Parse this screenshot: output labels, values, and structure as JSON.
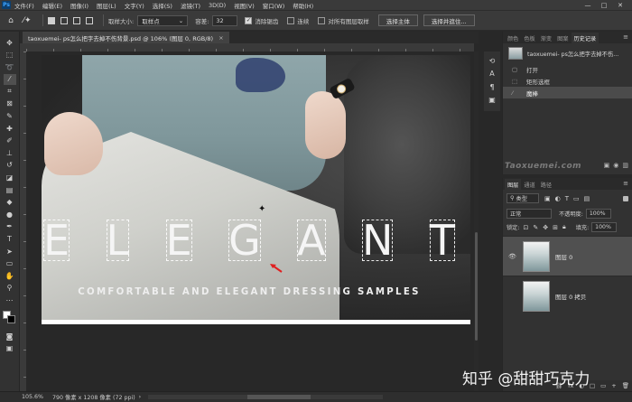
{
  "app": {
    "logo": "Ps"
  },
  "menu": [
    "文件(F)",
    "编辑(E)",
    "图像(I)",
    "图层(L)",
    "文字(Y)",
    "选择(S)",
    "滤镜(T)",
    "3D(D)",
    "视图(V)",
    "窗口(W)",
    "帮助(H)"
  ],
  "window_controls": {
    "minimize": "—",
    "maximize": "□",
    "close": "✕"
  },
  "options": {
    "sample_size_label": "取样大小:",
    "sample_size_value": "取样点",
    "tolerance_label": "容差:",
    "tolerance_value": "32",
    "anti_alias_label": "消除锯齿",
    "contiguous_label": "连续",
    "sample_all_layers_label": "对所有图层取样",
    "select_subject_label": "选择主体",
    "select_mask_label": "选择并遮住..."
  },
  "document": {
    "tab_title": "taoxuemei- ps怎么把字去掉不伤背景.psd @ 106% (图层 0, RGB/8)",
    "tab_close": "×",
    "heading": [
      "E",
      "L",
      "E",
      "G",
      "A",
      "N",
      "T"
    ],
    "subheading": "COMFORTABLE AND ELEGANT DRESSING SAMPLES"
  },
  "status": {
    "zoom": "105.6%",
    "doc_info": "790 像素 x 1208 像素 (72 ppi)",
    "arrow": "›"
  },
  "history_panel": {
    "tabs": [
      "颜色",
      "色板",
      "渐变",
      "图案",
      "历史记录"
    ],
    "active_tab": "历史记录",
    "menu_icon": "≡",
    "source_name": "taoxuemei- ps怎么把字去掉不伤...",
    "items": [
      {
        "label": "打开",
        "icon": "▢"
      },
      {
        "label": "矩形选框",
        "icon": "⬚"
      },
      {
        "label": "魔棒",
        "icon": "⁄"
      }
    ],
    "active_item": "魔棒",
    "watermark": "Taoxuemei.com"
  },
  "layers_panel": {
    "tabs": [
      "图层",
      "通道",
      "路径"
    ],
    "active_tab": "图层",
    "menu_icon": "≡",
    "filter_value": "类型",
    "blend_mode": "正常",
    "opacity_label": "不透明度:",
    "opacity_value": "100%",
    "lock_label": "锁定:",
    "fill_label": "填充:",
    "fill_value": "100%",
    "layers": [
      {
        "name": "图层 0",
        "visible": true
      },
      {
        "name": "图层 0 拷贝",
        "visible": false
      }
    ],
    "footer_icons": [
      "fx",
      "◐",
      "□",
      "▭",
      "+",
      "🗑"
    ]
  },
  "watermark_overlay": "知乎 @甜甜巧克力",
  "colors": {
    "panel_bg": "#323232",
    "menu_bg": "#3a3a3a",
    "active_row": "#505050",
    "arrow": "#e02020"
  }
}
